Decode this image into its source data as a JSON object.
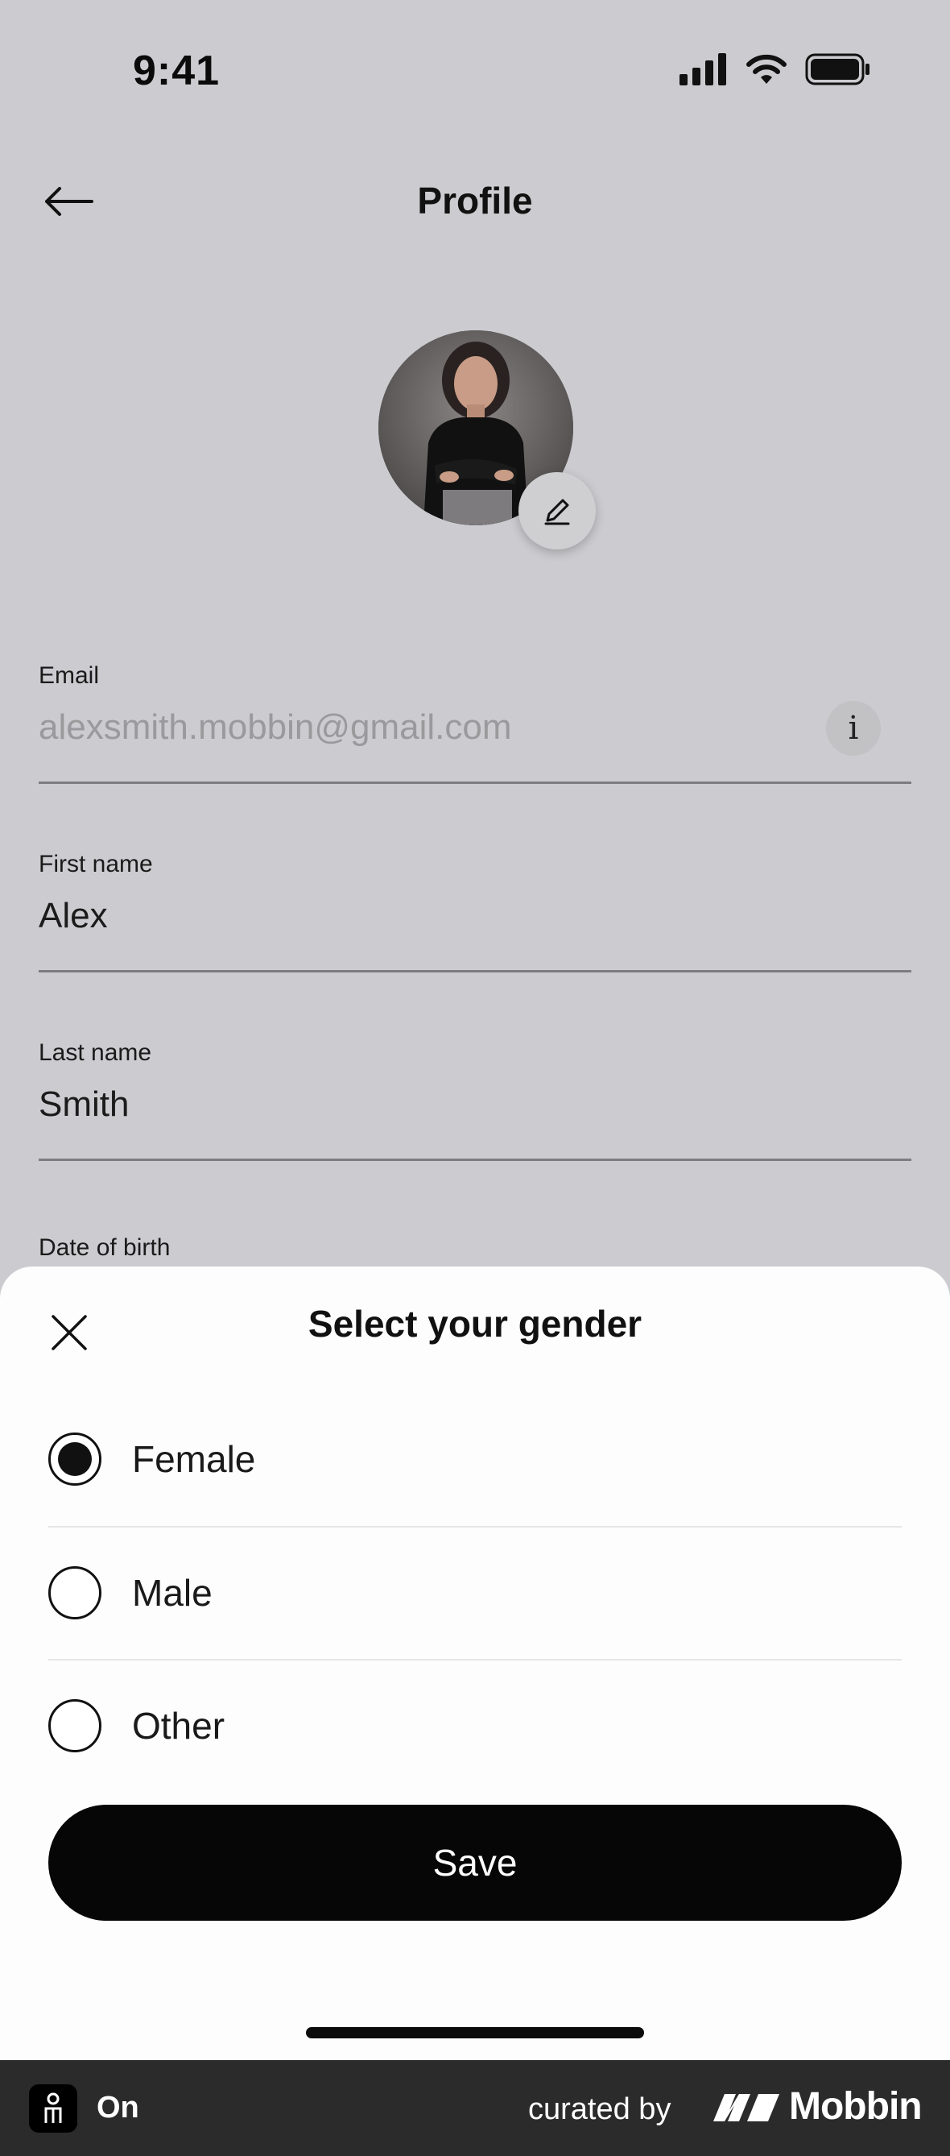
{
  "status_bar": {
    "time": "9:41",
    "icons": [
      "cellular-signal-icon",
      "wifi-icon",
      "battery-icon"
    ]
  },
  "header": {
    "title": "Profile",
    "back_icon": "arrow-left-icon"
  },
  "avatar": {
    "edit_icon": "pencil-icon"
  },
  "fields": {
    "email": {
      "label": "Email",
      "value": "alexsmith.mobbin@gmail.com",
      "info_glyph": "i"
    },
    "first_name": {
      "label": "First name",
      "value": "Alex"
    },
    "last_name": {
      "label": "Last name",
      "value": "Smith"
    },
    "date_of_birth": {
      "label": "Date of birth"
    }
  },
  "sheet": {
    "title": "Select your gender",
    "close_icon": "close-icon",
    "options": [
      {
        "label": "Female",
        "selected": true
      },
      {
        "label": "Male",
        "selected": false
      },
      {
        "label": "Other",
        "selected": false
      }
    ],
    "save_label": "Save"
  },
  "footer": {
    "toggle_label": "On",
    "curated_text": "curated by",
    "brand": "Mobbin"
  },
  "colors": {
    "dim_background": "#cccbcf",
    "sheet_background": "#fdfdfd",
    "primary_button": "#060606",
    "footer_background": "#2b2b2b"
  }
}
